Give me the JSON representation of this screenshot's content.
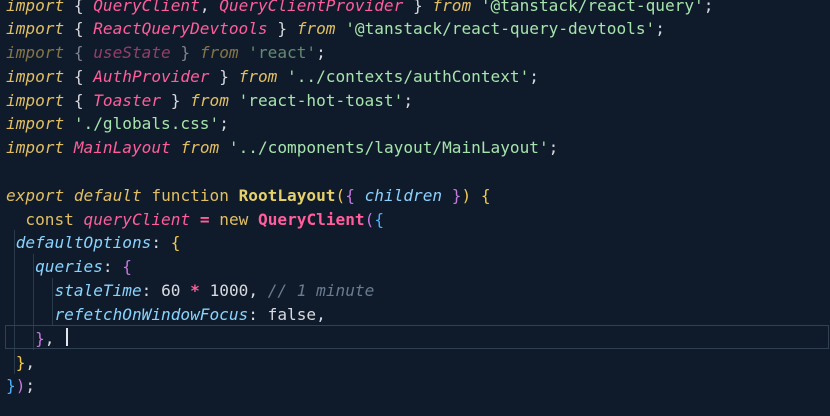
{
  "editor": {
    "lines": [
      [
        {
          "t": "import",
          "c": "kw-i"
        },
        {
          "t": " { ",
          "c": "punc"
        },
        {
          "t": "QueryClient",
          "c": "fn-b"
        },
        {
          "t": ", ",
          "c": "punc"
        },
        {
          "t": "QueryClientProvider",
          "c": "fn-b"
        },
        {
          "t": " } ",
          "c": "punc"
        },
        {
          "t": "from",
          "c": "kw-i"
        },
        {
          "t": " ",
          "c": "punc"
        },
        {
          "t": "'@tanstack/react-query'",
          "c": "str"
        },
        {
          "t": ";",
          "c": "punc"
        }
      ],
      [
        {
          "t": "import",
          "c": "kw-i"
        },
        {
          "t": " { ",
          "c": "punc"
        },
        {
          "t": "ReactQueryDevtools",
          "c": "fn-b"
        },
        {
          "t": " } ",
          "c": "punc"
        },
        {
          "t": "from",
          "c": "kw-i"
        },
        {
          "t": " ",
          "c": "punc"
        },
        {
          "t": "'@tanstack/react-query-devtools'",
          "c": "str"
        },
        {
          "t": ";",
          "c": "punc"
        }
      ],
      [
        {
          "t": "import",
          "c": "kw-i dim"
        },
        {
          "t": " { ",
          "c": "punc dim"
        },
        {
          "t": "useState",
          "c": "fn-b dim"
        },
        {
          "t": " } ",
          "c": "punc dim"
        },
        {
          "t": "from",
          "c": "kw-i dim"
        },
        {
          "t": " ",
          "c": "punc"
        },
        {
          "t": "'react'",
          "c": "str dim"
        },
        {
          "t": ";",
          "c": "punc"
        }
      ],
      [
        {
          "t": "import",
          "c": "kw-i"
        },
        {
          "t": " { ",
          "c": "punc"
        },
        {
          "t": "AuthProvider",
          "c": "fn-b"
        },
        {
          "t": " } ",
          "c": "punc"
        },
        {
          "t": "from",
          "c": "kw-i"
        },
        {
          "t": " ",
          "c": "punc"
        },
        {
          "t": "'../contexts/authContext'",
          "c": "str"
        },
        {
          "t": ";",
          "c": "punc"
        }
      ],
      [
        {
          "t": "import",
          "c": "kw-i"
        },
        {
          "t": " { ",
          "c": "punc"
        },
        {
          "t": "Toaster",
          "c": "fn-b"
        },
        {
          "t": " } ",
          "c": "punc"
        },
        {
          "t": "from",
          "c": "kw-i"
        },
        {
          "t": " ",
          "c": "punc"
        },
        {
          "t": "'react-hot-toast'",
          "c": "str"
        },
        {
          "t": ";",
          "c": "punc"
        }
      ],
      [
        {
          "t": "import",
          "c": "kw-i"
        },
        {
          "t": " ",
          "c": "punc"
        },
        {
          "t": "'./globals.css'",
          "c": "str"
        },
        {
          "t": ";",
          "c": "punc"
        }
      ],
      [
        {
          "t": "import",
          "c": "kw-i"
        },
        {
          "t": " ",
          "c": "punc"
        },
        {
          "t": "MainLayout",
          "c": "fn-b"
        },
        {
          "t": " ",
          "c": "punc"
        },
        {
          "t": "from",
          "c": "kw-i"
        },
        {
          "t": " ",
          "c": "punc"
        },
        {
          "t": "'../components/layout/MainLayout'",
          "c": "str"
        },
        {
          "t": ";",
          "c": "punc"
        }
      ],
      [],
      [
        {
          "t": "export",
          "c": "kw-i"
        },
        {
          "t": " ",
          "c": "punc"
        },
        {
          "t": "default",
          "c": "kw-i"
        },
        {
          "t": " ",
          "c": "punc"
        },
        {
          "t": "function",
          "c": "kw"
        },
        {
          "t": " ",
          "c": "punc"
        },
        {
          "t": "RootLayout",
          "c": "fnname"
        },
        {
          "t": "(",
          "c": "brace"
        },
        {
          "t": "{ ",
          "c": "brace2"
        },
        {
          "t": "children",
          "c": "param"
        },
        {
          "t": " }",
          "c": "brace2"
        },
        {
          "t": ")",
          "c": "brace"
        },
        {
          "t": " ",
          "c": "punc"
        },
        {
          "t": "{",
          "c": "brace"
        }
      ],
      [
        {
          "t": "  ",
          "c": "punc"
        },
        {
          "t": "const",
          "c": "kw"
        },
        {
          "t": " ",
          "c": "punc"
        },
        {
          "t": "queryClient",
          "c": "var"
        },
        {
          "t": " ",
          "c": "punc"
        },
        {
          "t": "=",
          "c": "op"
        },
        {
          "t": " ",
          "c": "punc"
        },
        {
          "t": "new",
          "c": "kw"
        },
        {
          "t": " ",
          "c": "punc"
        },
        {
          "t": "QueryClient",
          "c": "cls"
        },
        {
          "t": "(",
          "c": "brace2"
        },
        {
          "t": "{",
          "c": "brace3"
        }
      ],
      [
        {
          "t": " ",
          "c": "punc"
        },
        {
          "t": "defaultOptions",
          "c": "prop"
        },
        {
          "t": ": ",
          "c": "punc"
        },
        {
          "t": "{",
          "c": "brace"
        }
      ],
      [
        {
          "t": "   ",
          "c": "punc"
        },
        {
          "t": "queries",
          "c": "prop"
        },
        {
          "t": ": ",
          "c": "punc"
        },
        {
          "t": "{",
          "c": "brace2"
        }
      ],
      [
        {
          "t": "     ",
          "c": "punc"
        },
        {
          "t": "staleTime",
          "c": "prop"
        },
        {
          "t": ": ",
          "c": "punc"
        },
        {
          "t": "60",
          "c": "num"
        },
        {
          "t": " ",
          "c": "punc"
        },
        {
          "t": "*",
          "c": "op"
        },
        {
          "t": " ",
          "c": "punc"
        },
        {
          "t": "1000",
          "c": "num"
        },
        {
          "t": ", ",
          "c": "punc"
        },
        {
          "t": "// 1 minute",
          "c": "cmt"
        }
      ],
      [
        {
          "t": "     ",
          "c": "punc"
        },
        {
          "t": "refetchOnWindowFocus",
          "c": "prop"
        },
        {
          "t": ": ",
          "c": "punc"
        },
        {
          "t": "false",
          "c": "bool"
        },
        {
          "t": ",",
          "c": "punc"
        }
      ],
      [
        {
          "t": "   ",
          "c": "punc"
        },
        {
          "t": "}",
          "c": "brace2"
        },
        {
          "t": ",",
          "c": "punc"
        }
      ],
      [
        {
          "t": " ",
          "c": "punc"
        },
        {
          "t": "}",
          "c": "brace"
        },
        {
          "t": ",",
          "c": "punc"
        }
      ],
      [
        {
          "t": "}",
          "c": "brace3"
        },
        {
          "t": ")",
          "c": "brace2"
        },
        {
          "t": ";",
          "c": "punc"
        }
      ]
    ]
  }
}
